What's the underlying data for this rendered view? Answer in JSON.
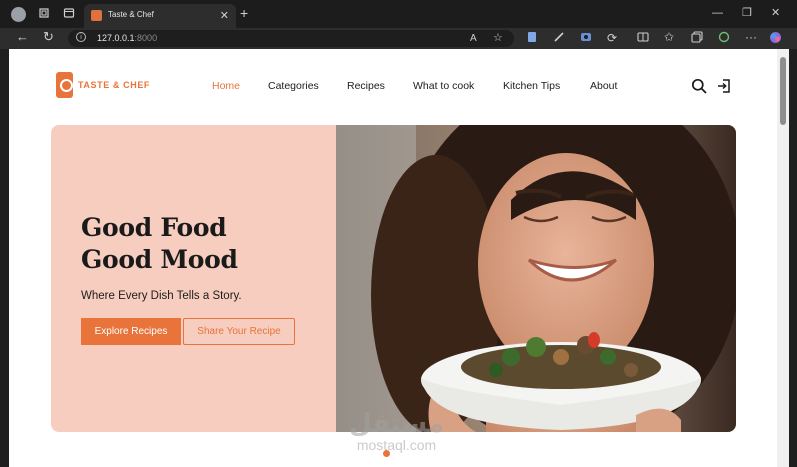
{
  "browser": {
    "tab_title": "Taste & Chef",
    "url_host": "127.0.0.1",
    "url_port": ":8000"
  },
  "site": {
    "logo_text": "TASTE & CHEF",
    "nav": [
      "Home",
      "Categories",
      "Recipes",
      "What to cook",
      "Kitchen Tips",
      "About"
    ],
    "active_nav": "Home"
  },
  "hero": {
    "title_line1": "Good Food",
    "title_line2": "Good Mood",
    "tagline": "Where Every Dish Tells a Story.",
    "primary_button": "Explore Recipes",
    "secondary_button": "Share Your Recipe"
  },
  "watermark": {
    "arabic": "مستقل",
    "latin": "mostaql.com"
  },
  "colors": {
    "accent": "#e8743b",
    "hero_bg": "#f6cdbf"
  },
  "icons": [
    "search-icon",
    "login-icon"
  ]
}
